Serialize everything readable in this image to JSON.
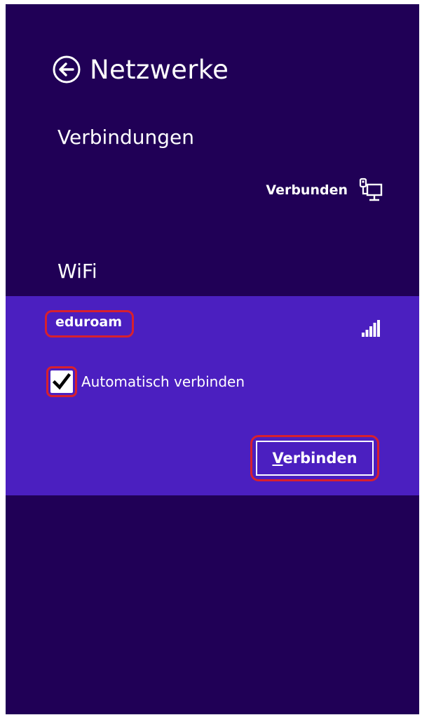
{
  "header": {
    "back_icon": "back-arrow-circle-icon",
    "title": "Netzwerke"
  },
  "connections": {
    "heading": "Verbindungen",
    "ethernet": {
      "status": "Verbunden",
      "icon": "wired-network-icon"
    }
  },
  "wifi": {
    "heading": "WiFi",
    "network": {
      "ssid": "eduroam",
      "signal_icon": "wifi-signal-strength-icon",
      "signal_level": 1.0,
      "auto_connect_label": "Automatisch verbinden",
      "auto_connect_checked": true,
      "connect_button_label": "Verbinden",
      "connect_button_access_key": "V"
    }
  },
  "colors": {
    "background": "#200056",
    "selected_item": "#4b1fc0",
    "highlight_annotation": "#d8202e",
    "text": "#ffffff"
  }
}
